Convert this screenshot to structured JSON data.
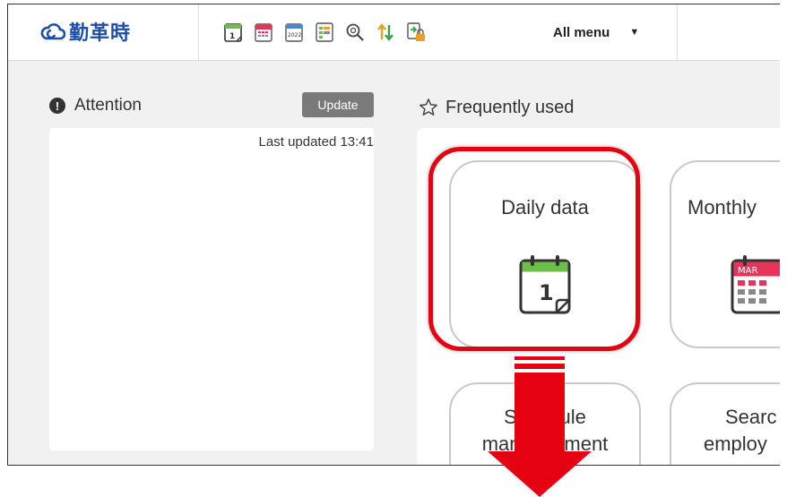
{
  "app": {
    "logo_text": "勤革時"
  },
  "toolbar": {
    "icons": [
      "daily-calendar-icon",
      "monthly-calendar-icon",
      "yearly-calendar-icon",
      "schedule-list-icon",
      "search-icon",
      "sort-icon",
      "export-lock-icon"
    ],
    "calendar_year": "2022",
    "all_menu_label": "All menu"
  },
  "attention": {
    "title": "Attention",
    "update_label": "Update",
    "last_updated": "Last updated 13:41"
  },
  "favorites": {
    "title": "Frequently used",
    "cards": [
      {
        "label": "Daily data",
        "icon": "daily-calendar-icon",
        "icon_number": "1",
        "highlighted": true
      },
      {
        "label": "Monthly",
        "icon": "monthly-calendar-icon",
        "icon_text": "MAR"
      },
      {
        "label_line1": "Schedule",
        "label_line2": "management",
        "visible_line1": "Sc      ule",
        "visible_line2": "man        ment"
      },
      {
        "label_line1": "Searc",
        "label_line2": "employ"
      }
    ]
  },
  "colors": {
    "accent_blue": "#1e4fa8",
    "highlight_red": "#e50012",
    "calendar_green": "#6cc04a",
    "calendar_pink": "#e8345a"
  }
}
